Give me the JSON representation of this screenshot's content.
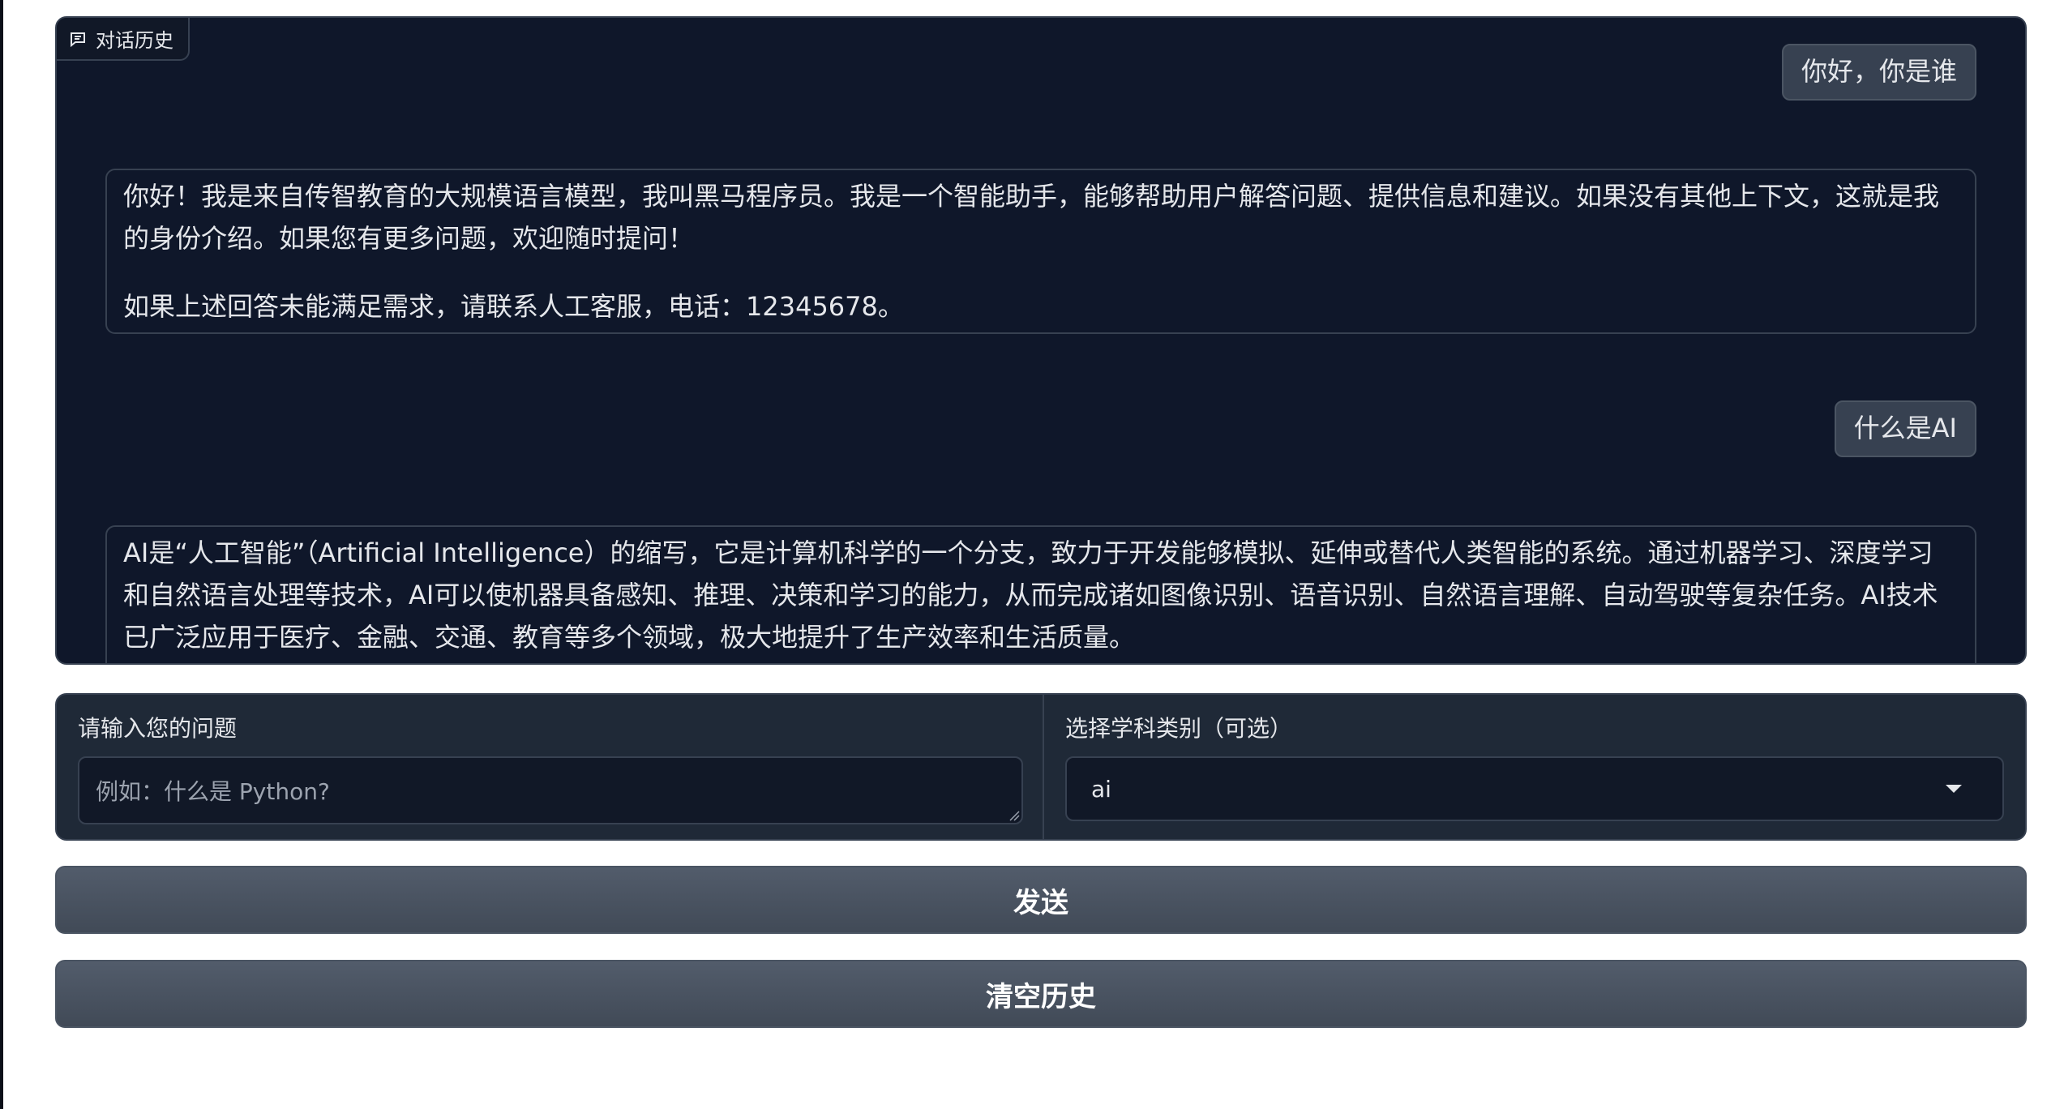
{
  "chat": {
    "label": "对话历史",
    "label_icon": "chat-bubble-icon",
    "messages": [
      {
        "role": "user",
        "text": "你好，你是谁"
      },
      {
        "role": "bot",
        "paragraphs": [
          "你好！我是来自传智教育的大规模语言模型，我叫黑马程序员。我是一个智能助手，能够帮助用户解答问题、提供信息和建议。如果没有其他上下文，这就是我的身份介绍。如果您有更多问题，欢迎随时提问！",
          "如果上述回答未能满足需求，请联系人工客服，电话：12345678。"
        ]
      },
      {
        "role": "user",
        "text": "什么是AI"
      },
      {
        "role": "bot",
        "paragraphs": [
          "AI是“人工智能”（Artificial Intelligence）的缩写，它是计算机科学的一个分支，致力于开发能够模拟、延伸或替代人类智能的系统。通过机器学习、深度学习和自然语言处理等技术，AI可以使机器具备感知、推理、决策和学习的能力，从而完成诸如图像识别、语音识别、自然语言理解、自动驾驶等复杂任务。AI技术已广泛应用于医疗、金融、交通、教育等多个领域，极大地提升了生产效率和生活质量。"
        ]
      }
    ]
  },
  "question": {
    "label": "请输入您的问题",
    "placeholder": "例如：什么是 Python?",
    "value": ""
  },
  "subject": {
    "label": "选择学科类别（可选）",
    "selected": "ai",
    "dropdown_icon": "caret-down-icon"
  },
  "buttons": {
    "send": "发送",
    "clear": "清空历史"
  },
  "colors": {
    "panel_bg": "#0f172a",
    "input_row_bg": "#1f2937",
    "button_bg": "#4b5563",
    "text": "#e5e7eb"
  }
}
